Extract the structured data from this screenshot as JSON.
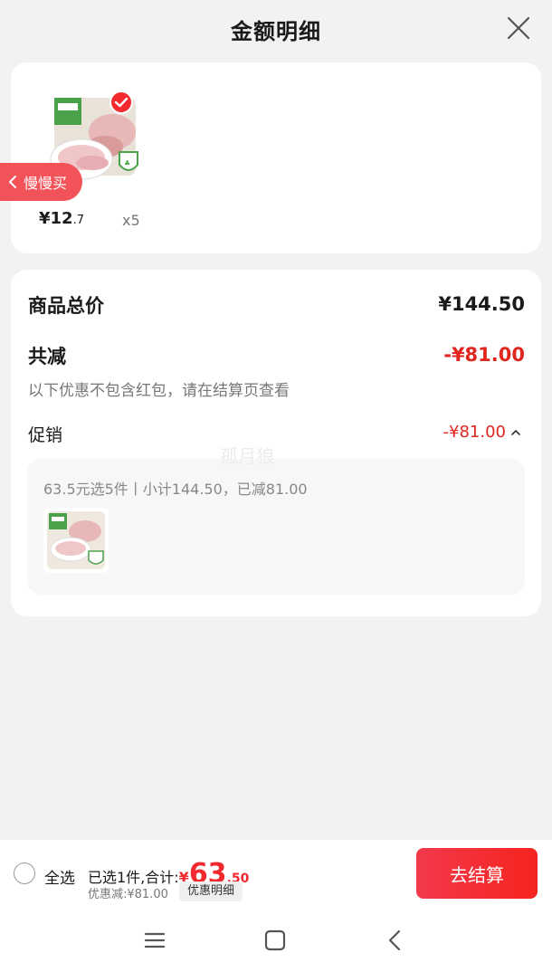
{
  "header": {
    "title": "金额明细"
  },
  "product": {
    "price_int": "¥12",
    "price_dec": ".7",
    "qty": "x5"
  },
  "slow_buy": "慢慢买",
  "breakdown": {
    "total_label": "商品总价",
    "total_value": "¥144.50",
    "reduce_label": "共减",
    "reduce_value": "-¥81.00",
    "note": "以下优惠不包含红包，请在结算页查看",
    "promo_label": "促销",
    "promo_value": "-¥81.00",
    "promo_desc": "63.5元选5件丨小计144.50，已减81.00"
  },
  "watermark": "孤月狼",
  "bottom": {
    "select_all": "全选",
    "summary_prefix": "已选1件,合计:",
    "total_yen": "¥",
    "total_int": "63",
    "total_dec": ".50",
    "discount": "优惠减:¥81.00",
    "detail_chip": "优惠明细",
    "checkout": "去结算"
  },
  "colors": {
    "accent": "#f2292e",
    "discount_red": "#e0261f",
    "tag": "#f25359"
  }
}
